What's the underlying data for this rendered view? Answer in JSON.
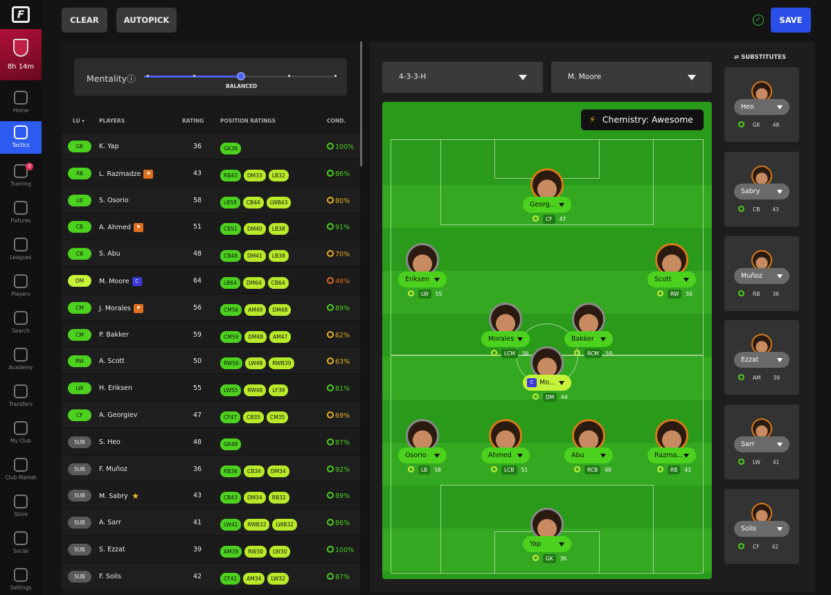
{
  "app": {
    "logo_letter": "F",
    "timer": "8h 14m"
  },
  "nav": [
    {
      "id": "home",
      "label": "Home",
      "icon": "home-icon"
    },
    {
      "id": "tactics",
      "label": "Tactics",
      "icon": "tactics-icon",
      "active": true
    },
    {
      "id": "training",
      "label": "Training",
      "icon": "training-cone-icon",
      "badge": "0"
    },
    {
      "id": "fixtures",
      "label": "Fixtures",
      "icon": "calendar-icon"
    },
    {
      "id": "leagues",
      "label": "Leagues",
      "icon": "ball-icon"
    },
    {
      "id": "players",
      "label": "Players",
      "icon": "people-icon"
    },
    {
      "id": "search",
      "label": "Search",
      "icon": "search-icon"
    },
    {
      "id": "academy",
      "label": "Academy",
      "icon": "academy-icon"
    },
    {
      "id": "transfers",
      "label": "Transfers",
      "icon": "tag-icon"
    },
    {
      "id": "myclub",
      "label": "My Club",
      "icon": "shield-icon"
    },
    {
      "id": "clubmarket",
      "label": "Club Market",
      "icon": "market-icon"
    },
    {
      "id": "store",
      "label": "Store",
      "icon": "handshake-icon"
    },
    {
      "id": "social",
      "label": "Social",
      "icon": "megaphone-icon"
    },
    {
      "id": "settings",
      "label": "Settings",
      "icon": "gear-icon"
    }
  ],
  "toolbar": {
    "clear": "CLEAR",
    "autopick": "AUTOPICK",
    "save": "SAVE",
    "saved_check": "✓"
  },
  "mentality": {
    "label": "Mentality",
    "info": "ⓘ",
    "value": "BALANCED",
    "level": 0.5
  },
  "table": {
    "headers": {
      "lu": "LU ▾",
      "players": "PLAYERS",
      "rating": "RATING",
      "position_ratings": "POSITION RATINGS",
      "cond": "COND."
    },
    "rows": [
      {
        "lu": "GK",
        "name": "K. Yap",
        "rating": "36",
        "chips": [
          "GK36"
        ],
        "cond": "100%",
        "level": "ok"
      },
      {
        "lu": "RB",
        "name": "L. Razmadze",
        "tag": "o",
        "rating": "43",
        "chips": [
          "RB43",
          "DM33",
          "LB32"
        ],
        "cond": "86%",
        "level": "ok"
      },
      {
        "lu": "LB",
        "name": "S. Osorio",
        "rating": "58",
        "chips": [
          "LB58",
          "CB44",
          "LWB43"
        ],
        "cond": "80%",
        "level": "mid"
      },
      {
        "lu": "CB",
        "name": "A. Ahmed",
        "tag": "o",
        "rating": "51",
        "chips": [
          "CB51",
          "DM40",
          "LB38"
        ],
        "cond": "91%",
        "level": "ok"
      },
      {
        "lu": "CB",
        "name": "S. Abu",
        "rating": "48",
        "chips": [
          "CB48",
          "DM41",
          "LB38"
        ],
        "cond": "70%",
        "level": "mid"
      },
      {
        "lu": "DM",
        "name": "M. Moore",
        "tag": "c",
        "rating": "64",
        "chips": [
          "LB64",
          "DM64",
          "CB64"
        ],
        "cond": "48%",
        "level": "low"
      },
      {
        "lu": "CM",
        "name": "J. Morales",
        "tag": "o",
        "rating": "56",
        "chips": [
          "CM56",
          "AM49",
          "DM48"
        ],
        "cond": "89%",
        "level": "ok"
      },
      {
        "lu": "CM",
        "name": "P. Bakker",
        "rating": "59",
        "chips": [
          "CM59",
          "DM48",
          "AM47"
        ],
        "cond": "62%",
        "level": "mid"
      },
      {
        "lu": "RW",
        "name": "A. Scott",
        "rating": "50",
        "chips": [
          "RW50",
          "LW48",
          "RWB39"
        ],
        "cond": "63%",
        "level": "mid"
      },
      {
        "lu": "LW",
        "name": "H. Eriksen",
        "rating": "55",
        "chips": [
          "LW55",
          "RW48",
          "LF39"
        ],
        "cond": "81%",
        "level": "ok"
      },
      {
        "lu": "CF",
        "name": "A. Georgiev",
        "rating": "47",
        "chips": [
          "CF47",
          "CB35",
          "CM35"
        ],
        "cond": "69%",
        "level": "mid"
      },
      {
        "lu": "SUB",
        "name": "S. Heo",
        "rating": "48",
        "chips": [
          "GK48"
        ],
        "cond": "87%",
        "level": "ok"
      },
      {
        "lu": "SUB",
        "name": "F. Muñoz",
        "rating": "36",
        "chips": [
          "RB36",
          "CB34",
          "DM34"
        ],
        "cond": "92%",
        "level": "ok"
      },
      {
        "lu": "SUB",
        "name": "M. Sabry",
        "tag": "s",
        "rating": "43",
        "chips": [
          "CB43",
          "DM34",
          "RB32"
        ],
        "cond": "89%",
        "level": "ok"
      },
      {
        "lu": "SUB",
        "name": "A. Sarr",
        "rating": "41",
        "chips": [
          "LW41",
          "RWB32",
          "LWB32"
        ],
        "cond": "86%",
        "level": "ok"
      },
      {
        "lu": "SUB",
        "name": "S. Ezzat",
        "rating": "39",
        "chips": [
          "AM39",
          "RW30",
          "LW30"
        ],
        "cond": "100%",
        "level": "ok"
      },
      {
        "lu": "SUB",
        "name": "F. Solis",
        "rating": "42",
        "chips": [
          "CF42",
          "AM34",
          "LW32"
        ],
        "cond": "87%",
        "level": "ok"
      }
    ]
  },
  "formation": {
    "value": "4-3-3-H"
  },
  "captain_select": {
    "value": "M. Moore"
  },
  "chemistry": {
    "icon": "⚡",
    "label": "Chemistry: Awesome"
  },
  "pitch_players": [
    {
      "name": "Georg...",
      "pos": "CF",
      "rating": "47"
    },
    {
      "name": "Eriksen",
      "pos": "LW",
      "rating": "55"
    },
    {
      "name": "Scott",
      "pos": "RW",
      "rating": "50"
    },
    {
      "name": "Morales",
      "pos": "LCM",
      "rating": "56"
    },
    {
      "name": "Bakker",
      "pos": "RCM",
      "rating": "59"
    },
    {
      "name": "Mo...",
      "pos": "DM",
      "rating": "64",
      "captain": "C"
    },
    {
      "name": "Osorio",
      "pos": "LB",
      "rating": "58"
    },
    {
      "name": "Ahmed",
      "pos": "LCB",
      "rating": "51"
    },
    {
      "name": "Abu",
      "pos": "RCB",
      "rating": "48"
    },
    {
      "name": "Razma...",
      "pos": "RB",
      "rating": "43"
    },
    {
      "name": "Yap",
      "pos": "GK",
      "rating": "36"
    }
  ],
  "substitutes": {
    "title": "SUBSTITUTES",
    "icon": "swap-icon",
    "players": [
      {
        "name": "Heo",
        "pos": "GK",
        "rating": "48"
      },
      {
        "name": "Sabry",
        "pos": "CB",
        "rating": "43"
      },
      {
        "name": "Muñoz",
        "pos": "RB",
        "rating": "36"
      },
      {
        "name": "Ezzat",
        "pos": "AM",
        "rating": "39"
      },
      {
        "name": "Sarr",
        "pos": "LW",
        "rating": "41"
      },
      {
        "name": "Solis",
        "pos": "CF",
        "rating": "42"
      }
    ]
  }
}
